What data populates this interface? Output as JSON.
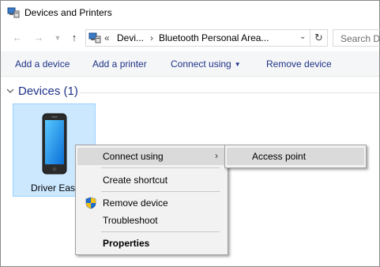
{
  "window": {
    "title": "Devices and Printers"
  },
  "icons": {
    "title_icon": "devices-printers-icon",
    "back": "back-arrow-icon",
    "forward": "forward-arrow-icon",
    "recent": "chevron-down-icon",
    "up": "up-arrow-icon",
    "refresh": "refresh-icon"
  },
  "address": {
    "prefix": "«",
    "crumb1": "Devi...",
    "sep": "›",
    "crumb2": "Bluetooth Personal Area..."
  },
  "search": {
    "placeholder": "Search De"
  },
  "toolbar": {
    "add_device": "Add a device",
    "add_printer": "Add a printer",
    "connect_using": "Connect using",
    "remove_device": "Remove device"
  },
  "group": {
    "title": "Devices (1)"
  },
  "device": {
    "name": "Driver Easy"
  },
  "context_menu": {
    "connect_using": "Connect using",
    "create_shortcut": "Create shortcut",
    "remove_device": "Remove device",
    "troubleshoot": "Troubleshoot",
    "properties": "Properties"
  },
  "submenu": {
    "access_point": "Access point"
  },
  "colors": {
    "link_blue": "#1e3287",
    "selection_fill": "#cce8ff",
    "selection_border": "#99d1ff",
    "menu_bg": "#f2f2f2",
    "menu_highlight": "#dadada"
  }
}
